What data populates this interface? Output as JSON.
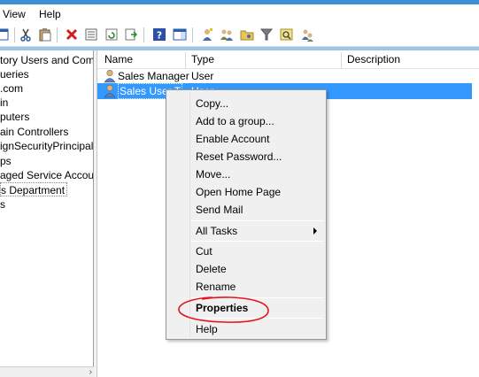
{
  "menubar": {
    "items": [
      "View",
      "Help"
    ]
  },
  "tree": {
    "items": [
      "tory Users and Com",
      "ueries",
      ".com",
      "in",
      "puters",
      "ain Controllers",
      "ignSecurityPrincipals",
      "ps",
      "aged Service Accour",
      "s Department",
      "s"
    ],
    "selected_index": 9
  },
  "list": {
    "columns": [
      "Name",
      "Type",
      "Description"
    ],
    "rows": [
      {
        "name": "Sales Manager",
        "type": "User",
        "icon": "user-icon"
      },
      {
        "name": "Sales User T",
        "type": "User",
        "icon": "user-icon",
        "selected": true
      }
    ]
  },
  "context_menu": {
    "items": [
      "Copy...",
      "Add to a group...",
      "Enable Account",
      "Reset Password...",
      "Move...",
      "Open Home Page",
      "Send Mail",
      "All Tasks",
      "Cut",
      "Delete",
      "Rename",
      "Properties",
      "Help"
    ],
    "submenu_item": "All Tasks",
    "default_item": "Properties"
  },
  "colors": {
    "selection": "#3399ff",
    "annotation": "#e8141a",
    "title_strip": "#3a8fd6",
    "menu_background": "#f0f0f0"
  }
}
